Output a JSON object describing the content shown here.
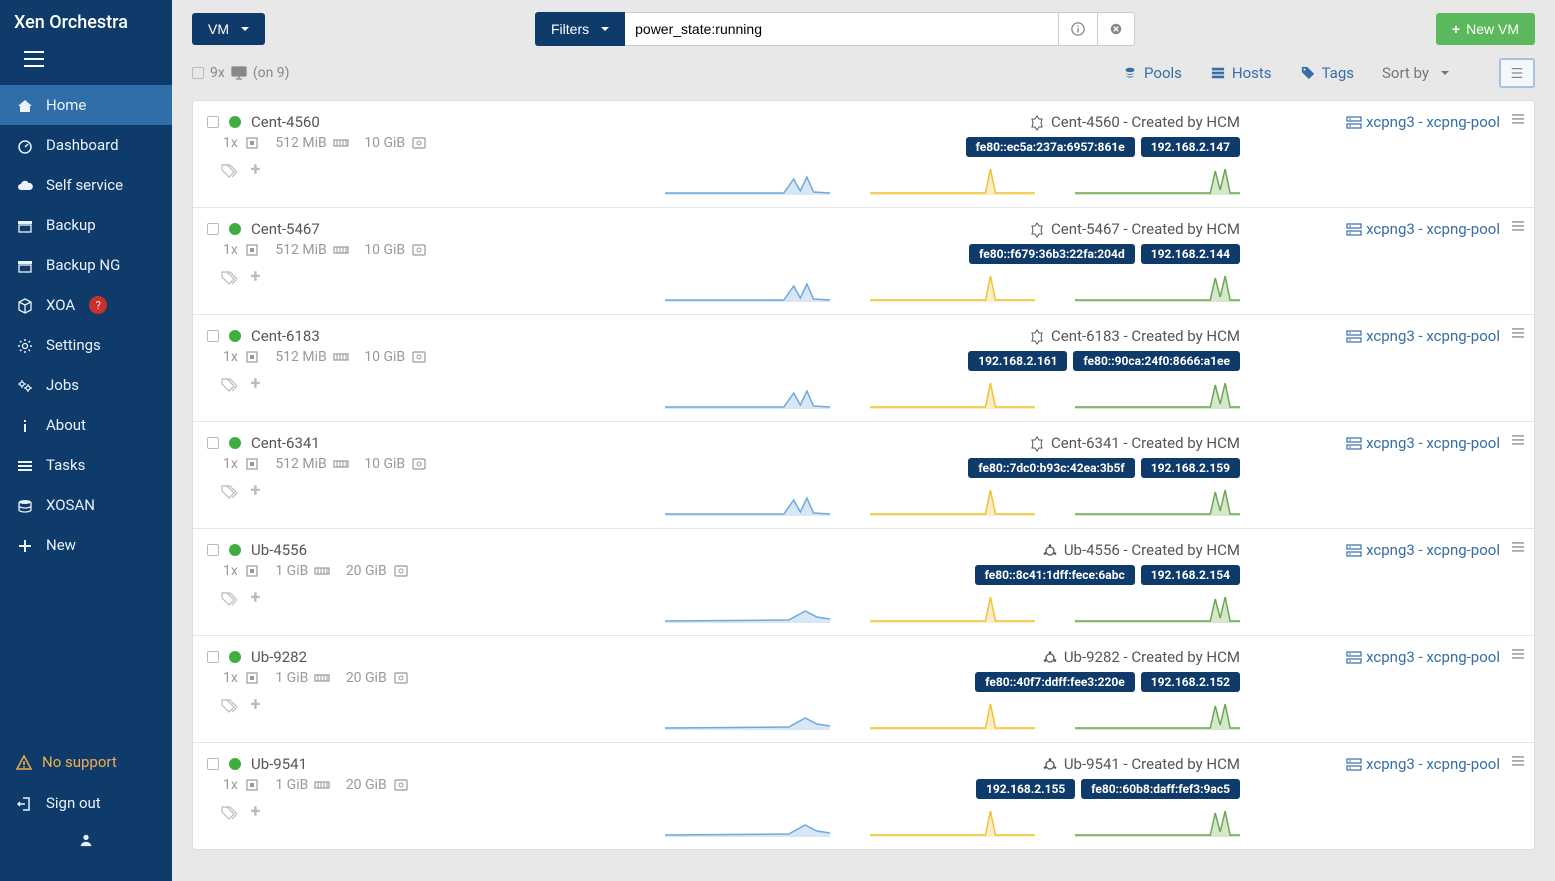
{
  "brand": "Xen Orchestra",
  "sidebar": {
    "items": [
      {
        "icon": "home",
        "label": "Home",
        "active": true
      },
      {
        "icon": "dashboard",
        "label": "Dashboard"
      },
      {
        "icon": "cloud",
        "label": "Self service"
      },
      {
        "icon": "archive",
        "label": "Backup"
      },
      {
        "icon": "archive",
        "label": "Backup NG"
      },
      {
        "icon": "cube",
        "label": "XOA",
        "badge": "?"
      },
      {
        "icon": "gear",
        "label": "Settings"
      },
      {
        "icon": "gears",
        "label": "Jobs"
      },
      {
        "icon": "info",
        "label": "About"
      },
      {
        "icon": "list",
        "label": "Tasks"
      },
      {
        "icon": "stack",
        "label": "XOSAN"
      },
      {
        "icon": "plus",
        "label": "New"
      }
    ],
    "warning": "No support",
    "signout": "Sign out"
  },
  "topbar": {
    "vm_btn": "VM",
    "filters_btn": "Filters",
    "search_value": "power_state:running",
    "new_vm": "New VM"
  },
  "filterbar": {
    "count_prefix": "9x",
    "count_suffix": "(on 9)",
    "pools": "Pools",
    "hosts": "Hosts",
    "tags": "Tags",
    "sortby": "Sort by"
  },
  "host_link": "xcpng3 - xcpng-pool",
  "vms": [
    {
      "os": "centos",
      "name": "Cent-4560",
      "cpu": "1x",
      "ram": "512 MiB",
      "disk": "10 GiB",
      "desc": "Cent-4560 - Created by HCM",
      "ips": [
        "fe80::ec5a:237a:6957:861e",
        "192.168.2.147"
      ]
    },
    {
      "os": "centos",
      "name": "Cent-5467",
      "cpu": "1x",
      "ram": "512 MiB",
      "disk": "10 GiB",
      "desc": "Cent-5467 - Created by HCM",
      "ips": [
        "fe80::f679:36b3:22fa:204d",
        "192.168.2.144"
      ]
    },
    {
      "os": "centos",
      "name": "Cent-6183",
      "cpu": "1x",
      "ram": "512 MiB",
      "disk": "10 GiB",
      "desc": "Cent-6183 - Created by HCM",
      "ips": [
        "192.168.2.161",
        "fe80::90ca:24f0:8666:a1ee"
      ]
    },
    {
      "os": "centos",
      "name": "Cent-6341",
      "cpu": "1x",
      "ram": "512 MiB",
      "disk": "10 GiB",
      "desc": "Cent-6341 - Created by HCM",
      "ips": [
        "fe80::7dc0:b93c:42ea:3b5f",
        "192.168.2.159"
      ]
    },
    {
      "os": "ubuntu",
      "name": "Ub-4556",
      "cpu": "1x",
      "ram": "1 GiB",
      "disk": "20 GiB",
      "desc": "Ub-4556 - Created by HCM",
      "ips": [
        "fe80::8c41:1dff:fece:6abc",
        "192.168.2.154"
      ]
    },
    {
      "os": "ubuntu",
      "name": "Ub-9282",
      "cpu": "1x",
      "ram": "1 GiB",
      "disk": "20 GiB",
      "desc": "Ub-9282 - Created by HCM",
      "ips": [
        "fe80::40f7:ddff:fee3:220e",
        "192.168.2.152"
      ]
    },
    {
      "os": "ubuntu",
      "name": "Ub-9541",
      "cpu": "1x",
      "ram": "1 GiB",
      "disk": "20 GiB",
      "desc": "Ub-9541 - Created by HCM",
      "ips": [
        "192.168.2.155",
        "fe80::60b8:daff:fef3:9ac5"
      ]
    }
  ]
}
